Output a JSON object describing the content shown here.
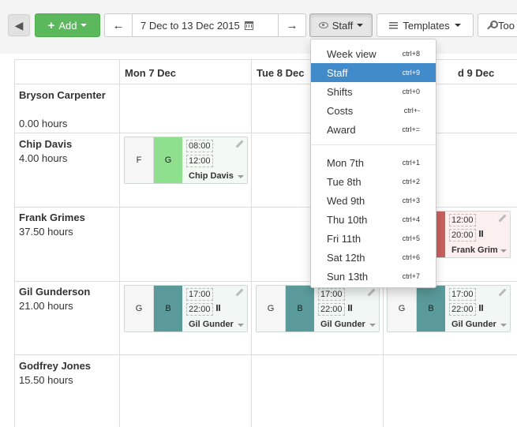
{
  "toolbar": {
    "add_label": "Add",
    "date_range": "7 Dec to 13 Dec 2015",
    "view_label": "Staff",
    "templates_label": "Templates",
    "tools_label": "Too"
  },
  "days": [
    "Mon 7 Dec",
    "Tue 8 Dec",
    "d 9 Dec"
  ],
  "staff": [
    {
      "name": "Bryson Carpenter",
      "hours": "0.00 hours"
    },
    {
      "name": "Chip Davis",
      "hours": "4.00 hours"
    },
    {
      "name": "Frank Grimes",
      "hours": "37.50 hours"
    },
    {
      "name": "Gil Gunderson",
      "hours": "21.00 hours"
    },
    {
      "name": "Godfrey Jones",
      "hours": "15.50 hours"
    }
  ],
  "shifts": {
    "chip_mon": {
      "role": "F",
      "area": "G",
      "start": "08:00",
      "end": "12:00",
      "name": "Chip Davis",
      "area_color": "#8ee08e"
    },
    "frank_wed": {
      "start": "12:00",
      "end": "20:00",
      "name": "Frank Grim",
      "area_color": "#c9605e"
    },
    "gil_mon": {
      "role": "G",
      "area": "B",
      "start": "17:00",
      "end": "22:00",
      "name": "Gil Gunder",
      "area_color": "#5a9a9a"
    },
    "gil_tue": {
      "role": "G",
      "area": "B",
      "start": "17:00",
      "end": "22:00",
      "name": "Gil Gunder",
      "area_color": "#5a9a9a"
    },
    "gil_wed": {
      "role": "G",
      "area": "B",
      "start": "17:00",
      "end": "22:00",
      "name": "Gil Gunder",
      "area_color": "#5a9a9a"
    }
  },
  "menu": {
    "items": [
      {
        "label": "Week view",
        "kbd": "ctrl+8"
      },
      {
        "label": "Staff",
        "kbd": "ctrl+9"
      },
      {
        "label": "Shifts",
        "kbd": "ctrl+0"
      },
      {
        "label": "Costs",
        "kbd": "ctrl+-"
      },
      {
        "label": "Award",
        "kbd": "ctrl+="
      }
    ],
    "days": [
      {
        "label": "Mon 7th",
        "kbd": "ctrl+1"
      },
      {
        "label": "Tue 8th",
        "kbd": "ctrl+2"
      },
      {
        "label": "Wed 9th",
        "kbd": "ctrl+3"
      },
      {
        "label": "Thu 10th",
        "kbd": "ctrl+4"
      },
      {
        "label": "Fri 11th",
        "kbd": "ctrl+5"
      },
      {
        "label": "Sat 12th",
        "kbd": "ctrl+6"
      },
      {
        "label": "Sun 13th",
        "kbd": "ctrl+7"
      }
    ]
  },
  "colors": {
    "accent": "#428bca",
    "add_green": "#5cb85c"
  }
}
